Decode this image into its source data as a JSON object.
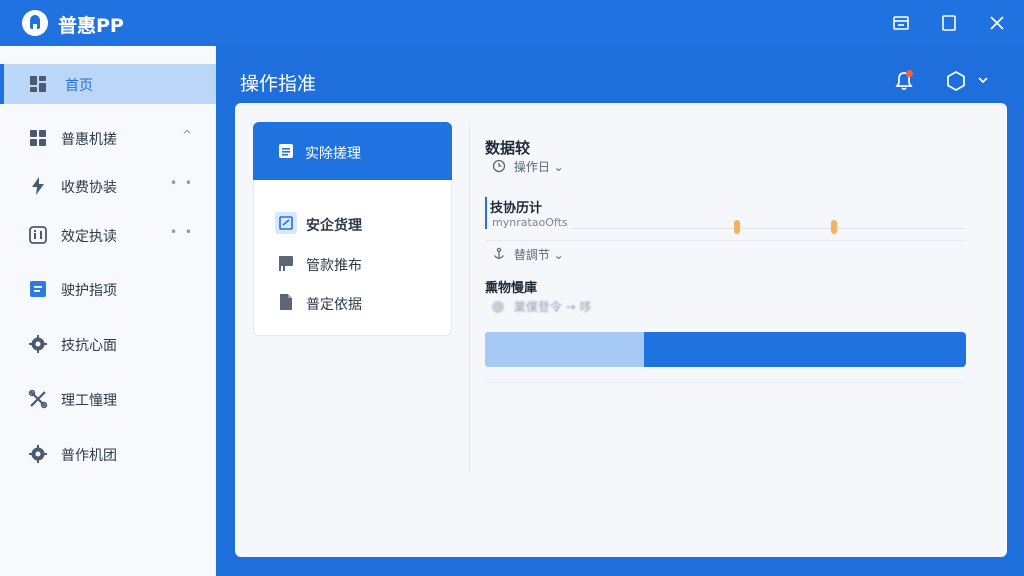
{
  "app": {
    "title": "普惠PP"
  },
  "sidebar": {
    "items": [
      {
        "label": "首页",
        "icon": "dashboard-icon",
        "active": true
      },
      {
        "label": "普惠机搓",
        "icon": "grid-icon",
        "extra": "^"
      },
      {
        "label": "收费协装",
        "icon": "lightning-icon",
        "extra": "• •"
      },
      {
        "label": "效定执读",
        "icon": "info-box-icon",
        "extra": "• •"
      },
      {
        "label": "驶护指项",
        "icon": "document-icon"
      },
      {
        "label": "技抗心面",
        "icon": "gear-icon"
      },
      {
        "label": "理工憧理",
        "icon": "tools-icon"
      },
      {
        "label": "普作机团",
        "icon": "gear-icon"
      }
    ]
  },
  "header": {
    "title": "操作指准"
  },
  "subnav": {
    "active_label": "实除搓理",
    "items": [
      {
        "label": "安企货理",
        "icon": "card-icon"
      },
      {
        "label": "管款推布",
        "icon": "flag-icon"
      },
      {
        "label": "普定依据",
        "icon": "file-icon"
      }
    ]
  },
  "detail": {
    "section_title": "数据较",
    "dropdown1": "操作日",
    "field_label": "技协历计",
    "field_value": "mynrataoOfts",
    "dropdown2": "替調节",
    "section2_title": "熏物慢庫",
    "blurred_text": "業僕登令 → 哆",
    "progress_fraction": 0.33
  },
  "colors": {
    "accent": "#1f72e0",
    "marker": "#f3b35c",
    "notification": "#ff5a4e"
  }
}
